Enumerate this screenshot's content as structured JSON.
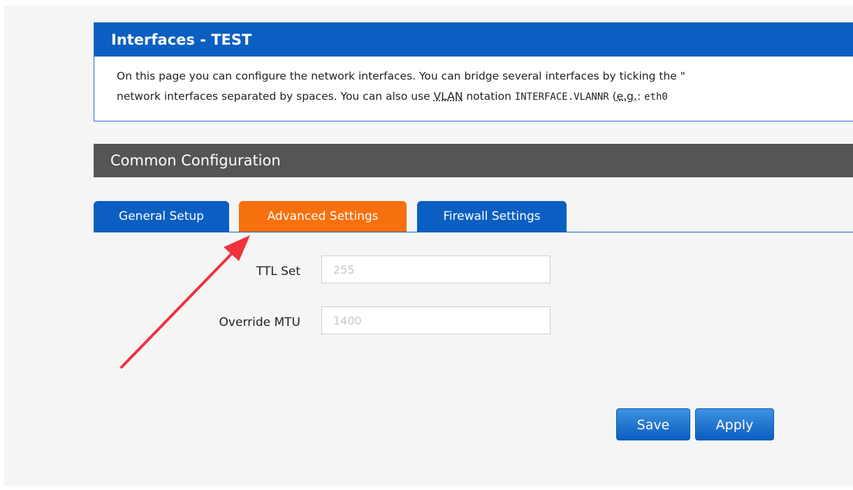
{
  "header": {
    "title": "Interfaces - TEST",
    "desc_line1": "On this page you can configure the network interfaces. You can bridge several interfaces by ticking the \"",
    "desc_line2_prefix": "network interfaces separated by spaces. You can also use ",
    "desc_vlan": "VLAN",
    "desc_notation": " notation ",
    "desc_mono": "INTERFACE.VLANNR",
    "desc_paren": " (",
    "desc_eg": "e.g.",
    "desc_colon": ": ",
    "desc_tail": "eth0"
  },
  "section": {
    "title": "Common Configuration"
  },
  "tabs": [
    {
      "label": "General Setup",
      "active": false
    },
    {
      "label": "Advanced Settings",
      "active": true
    },
    {
      "label": "Firewall Settings",
      "active": false
    }
  ],
  "form": {
    "ttl_label": "TTL Set",
    "ttl_placeholder": "255",
    "mtu_label": "Override MTU",
    "mtu_placeholder": "1400"
  },
  "buttons": {
    "save": "Save",
    "apply": "Apply"
  },
  "annotation": {
    "arrow_color": "#f0323c"
  },
  "colors": {
    "primary_blue": "#0b5fc2",
    "active_tab_orange": "#f7700e",
    "section_gray": "#555555"
  }
}
